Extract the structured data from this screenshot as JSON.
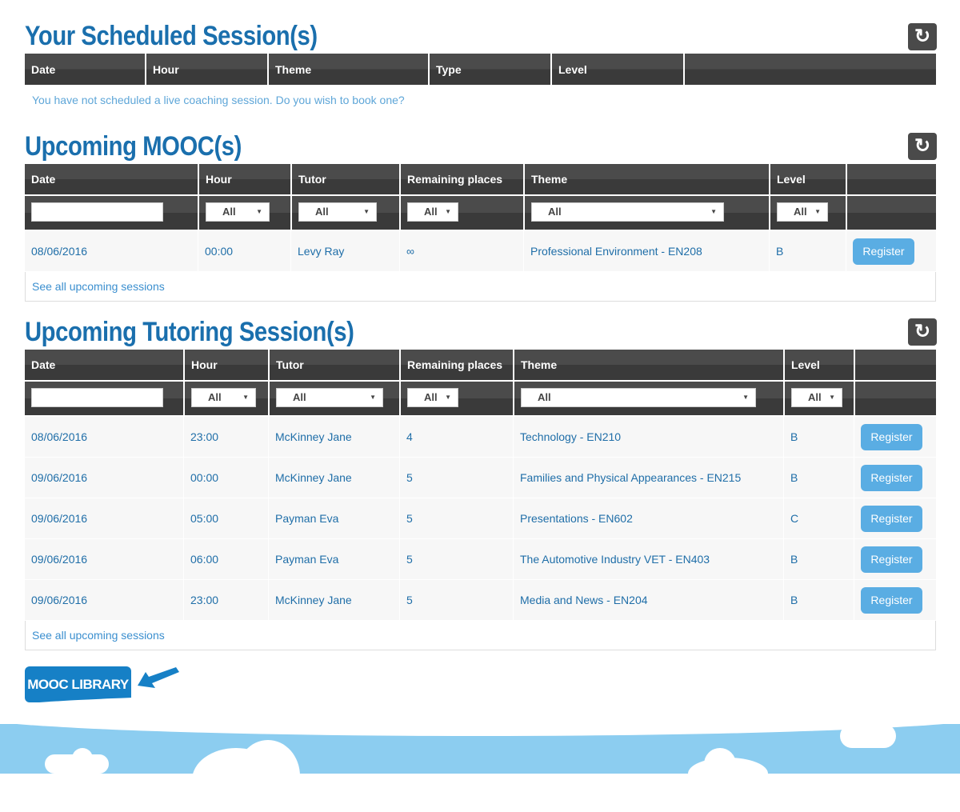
{
  "colors": {
    "title": "#1a6fad",
    "header": "#444444",
    "link": "#1f6ea8",
    "register": "#5aade3",
    "library": "#1680c6",
    "sky": "#8ccdf0"
  },
  "scheduled": {
    "title": "Your Scheduled Session(s)",
    "refresh_icon": "refresh-icon",
    "columns": [
      "Date",
      "Hour",
      "Theme",
      "Type",
      "Level",
      ""
    ],
    "empty_message": "You have not scheduled a live coaching session. Do you wish to book one?"
  },
  "mooc": {
    "title": "Upcoming MOOC(s)",
    "refresh_icon": "refresh-icon",
    "columns": [
      "Date",
      "Hour",
      "Tutor",
      "Remaining places",
      "Theme",
      "Level",
      ""
    ],
    "filters": [
      "",
      "All",
      "All",
      "All",
      "All",
      "All"
    ],
    "rows": [
      [
        "08/06/2016",
        "00:00",
        "Levy Ray",
        "∞",
        "Professional Environment - EN208",
        "B",
        "Register"
      ]
    ],
    "see_all": "See all upcoming sessions"
  },
  "tutoring": {
    "title": "Upcoming Tutoring Session(s)",
    "refresh_icon": "refresh-icon",
    "columns": [
      "Date",
      "Hour",
      "Tutor",
      "Remaining places",
      "Theme",
      "Level",
      ""
    ],
    "filters": [
      "",
      "All",
      "All",
      "All",
      "All",
      "All"
    ],
    "rows": [
      [
        "08/06/2016",
        "23:00",
        "McKinney Jane",
        "4",
        "Technology - EN210",
        "B",
        "Register"
      ],
      [
        "09/06/2016",
        "00:00",
        "McKinney Jane",
        "5",
        "Families and Physical Appearances - EN215",
        "B",
        "Register"
      ],
      [
        "09/06/2016",
        "05:00",
        "Payman Eva",
        "5",
        "Presentations - EN602",
        "C",
        "Register"
      ],
      [
        "09/06/2016",
        "06:00",
        "Payman Eva",
        "5",
        "The Automotive Industry VET - EN403",
        "B",
        "Register"
      ],
      [
        "09/06/2016",
        "23:00",
        "McKinney Jane",
        "5",
        "Media and News - EN204",
        "B",
        "Register"
      ]
    ],
    "see_all": "See all upcoming sessions"
  },
  "library_button": "MOOC LIBRARY"
}
